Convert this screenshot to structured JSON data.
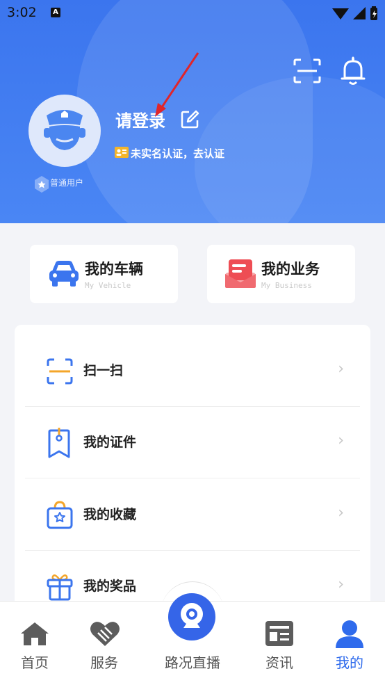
{
  "status": {
    "time": "3:02",
    "badge": "A"
  },
  "header": {
    "login_text": "请登录",
    "cert_text": "未实名认证，去认证",
    "user_type": "普通用户"
  },
  "quick": [
    {
      "title": "我的车辆",
      "sub": "My Vehicle",
      "icon": "car-icon"
    },
    {
      "title": "我的业务",
      "sub": "My Business",
      "icon": "business-icon"
    }
  ],
  "menu": [
    {
      "label": "扫一扫",
      "icon": "scan-icon"
    },
    {
      "label": "我的证件",
      "icon": "certificate-icon"
    },
    {
      "label": "我的收藏",
      "icon": "favorite-bag-icon"
    },
    {
      "label": "我的奖品",
      "icon": "gift-icon"
    }
  ],
  "chevron": "›",
  "tabs": [
    {
      "label": "首页",
      "icon": "home-icon"
    },
    {
      "label": "服务",
      "icon": "service-icon"
    },
    {
      "label": "路况直播",
      "icon": "live-camera-icon"
    },
    {
      "label": "资讯",
      "icon": "news-icon"
    },
    {
      "label": "我的",
      "icon": "profile-icon"
    }
  ],
  "colors": {
    "accent": "#2f6bec",
    "header": "#3b75ee",
    "annotation_arrow": "#e0252b"
  }
}
